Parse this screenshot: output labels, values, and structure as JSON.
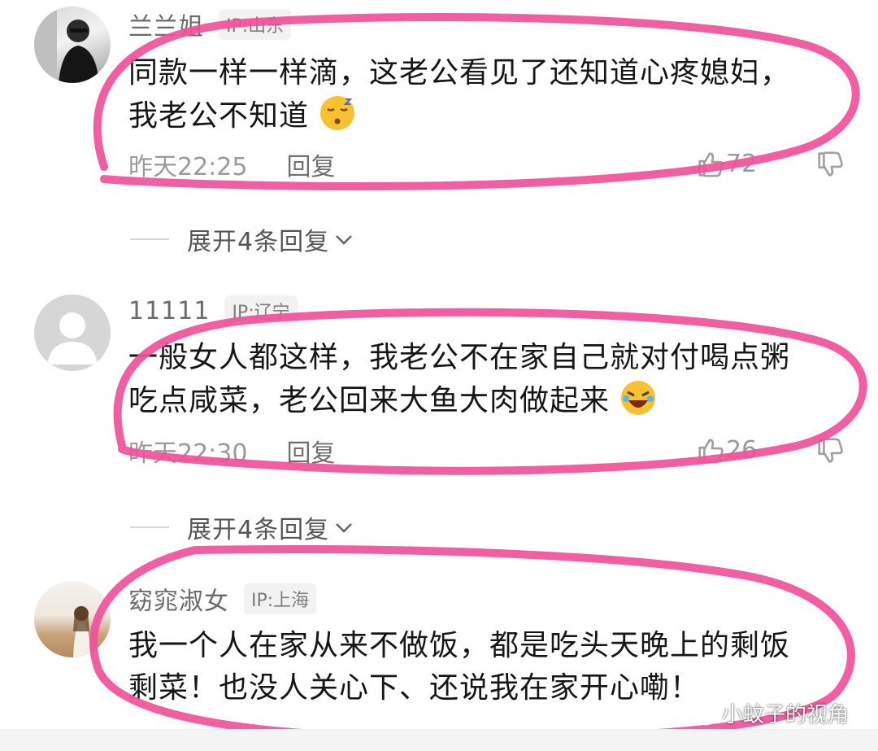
{
  "comments": [
    {
      "username": "兰兰姐",
      "ip": "IP:山东",
      "text_line1": "同款一样一样滴，这老公看见了还知道心疼媳妇，",
      "text_line2": "我老公不知道",
      "emoji": "sleepy-face-emoji",
      "time": "昨天22:25",
      "reply_label": "回复",
      "likes": "72",
      "expand_label": "展开4条回复"
    },
    {
      "username": "11111",
      "ip": "IP:辽宁",
      "text_line1": "一般女人都这样，我老公不在家自己就对付喝点粥",
      "text_line2": "吃点咸菜，老公回来大鱼大肉做起来",
      "emoji": "rofl-face-emoji",
      "time": "昨天22:30",
      "reply_label": "回复",
      "likes": "26",
      "expand_label": "展开4条回复"
    },
    {
      "username": "窈窕淑女",
      "ip": "IP:上海",
      "text_line1": "我一个人在家从来不做饭，都是吃头天晚上的剩饭",
      "text_line2": "剩菜！也没人关心下、还说我在家开心嘞！"
    }
  ],
  "watermark": {
    "text": "小蚊子的视角",
    "icon": "wechat-icon"
  },
  "annotation_color": "#f0509a"
}
